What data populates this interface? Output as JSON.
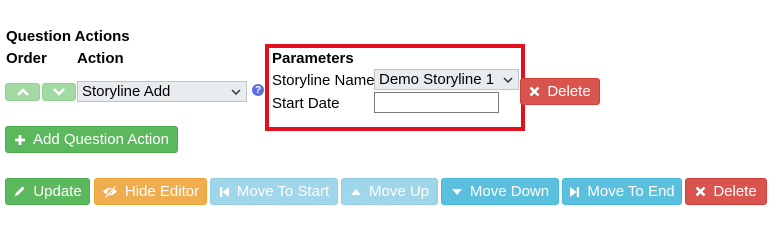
{
  "section": {
    "title": "Question Actions",
    "col_order": "Order",
    "col_action": "Action",
    "col_parameters": "Parameters"
  },
  "action_row": {
    "action_select_value": "Storyline Add",
    "help_glyph": "?",
    "param_storyline_label": "Storyline Name",
    "param_storyline_value": "Demo Storyline 1",
    "param_startdate_label": "Start Date",
    "param_startdate_value": "",
    "delete_label": "Delete"
  },
  "add_action_label": "Add Question Action",
  "toolbar": {
    "update": "Update",
    "hide_editor": "Hide Editor",
    "move_to_start": "Move To Start",
    "move_up": "Move Up",
    "move_down": "Move Down",
    "move_to_end": "Move To End",
    "delete": "Delete"
  },
  "icons": {
    "up": "chevron-up-icon",
    "down": "chevron-down-icon",
    "help": "help-icon",
    "delete": "close-icon",
    "add": "plus-icon",
    "update": "pencil-icon",
    "hide": "eye-slash-icon",
    "start": "step-backward-icon",
    "move_up": "triangle-up-icon",
    "move_down": "triangle-down-icon",
    "end": "step-forward-icon"
  },
  "colors": {
    "success": "#5cb85c",
    "warning": "#f0ad4e",
    "info": "#5bc0de",
    "danger": "#d9534f",
    "highlight": "#e3101d"
  }
}
